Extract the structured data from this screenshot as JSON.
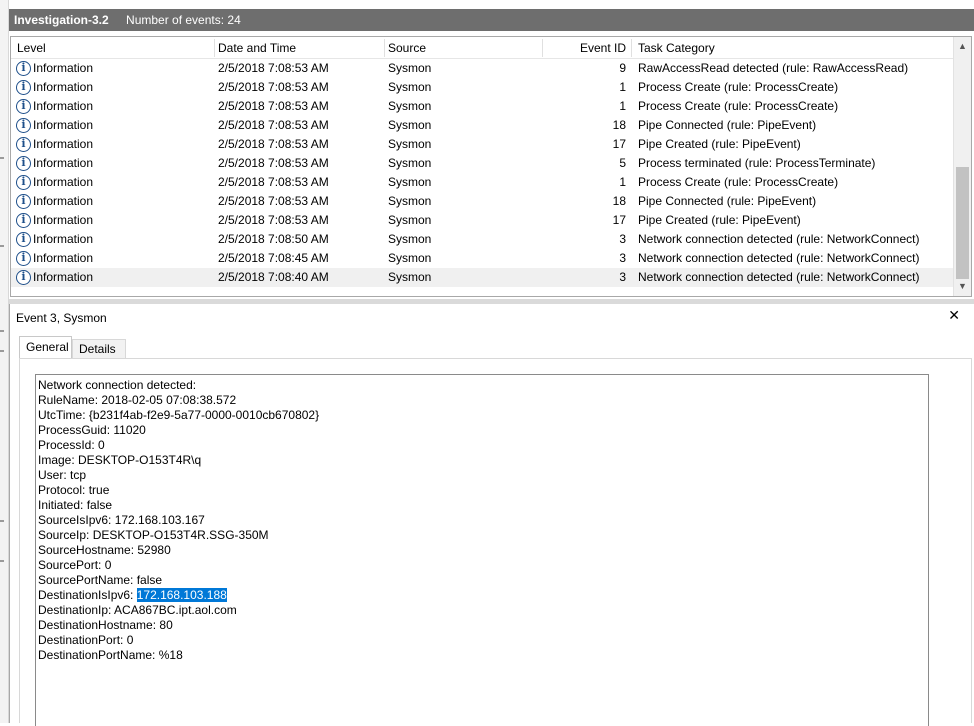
{
  "header": {
    "title": "Investigation-3.2",
    "event_count": "Number of events: 24"
  },
  "columns": {
    "level": "Level",
    "date": "Date and Time",
    "source": "Source",
    "event_id": "Event ID",
    "task": "Task Category"
  },
  "rows": [
    {
      "level": "Information",
      "date": "2/5/2018 7:08:53 AM",
      "source": "Sysmon",
      "event_id": "9",
      "task": "RawAccessRead detected (rule: RawAccessRead)"
    },
    {
      "level": "Information",
      "date": "2/5/2018 7:08:53 AM",
      "source": "Sysmon",
      "event_id": "1",
      "task": "Process Create (rule: ProcessCreate)"
    },
    {
      "level": "Information",
      "date": "2/5/2018 7:08:53 AM",
      "source": "Sysmon",
      "event_id": "1",
      "task": "Process Create (rule: ProcessCreate)"
    },
    {
      "level": "Information",
      "date": "2/5/2018 7:08:53 AM",
      "source": "Sysmon",
      "event_id": "18",
      "task": "Pipe Connected (rule: PipeEvent)"
    },
    {
      "level": "Information",
      "date": "2/5/2018 7:08:53 AM",
      "source": "Sysmon",
      "event_id": "17",
      "task": "Pipe Created (rule: PipeEvent)"
    },
    {
      "level": "Information",
      "date": "2/5/2018 7:08:53 AM",
      "source": "Sysmon",
      "event_id": "5",
      "task": "Process terminated (rule: ProcessTerminate)"
    },
    {
      "level": "Information",
      "date": "2/5/2018 7:08:53 AM",
      "source": "Sysmon",
      "event_id": "1",
      "task": "Process Create (rule: ProcessCreate)"
    },
    {
      "level": "Information",
      "date": "2/5/2018 7:08:53 AM",
      "source": "Sysmon",
      "event_id": "18",
      "task": "Pipe Connected (rule: PipeEvent)"
    },
    {
      "level": "Information",
      "date": "2/5/2018 7:08:53 AM",
      "source": "Sysmon",
      "event_id": "17",
      "task": "Pipe Created (rule: PipeEvent)"
    },
    {
      "level": "Information",
      "date": "2/5/2018 7:08:50 AM",
      "source": "Sysmon",
      "event_id": "3",
      "task": "Network connection detected (rule: NetworkConnect)"
    },
    {
      "level": "Information",
      "date": "2/5/2018 7:08:45 AM",
      "source": "Sysmon",
      "event_id": "3",
      "task": "Network connection detected (rule: NetworkConnect)"
    },
    {
      "level": "Information",
      "date": "2/5/2018 7:08:40 AM",
      "source": "Sysmon",
      "event_id": "3",
      "task": "Network connection detected (rule: NetworkConnect)"
    }
  ],
  "detail": {
    "title": "Event 3, Sysmon",
    "close_glyph": "✕",
    "tabs": {
      "general": "General",
      "details": "Details"
    },
    "lines": [
      {
        "text": "Network connection detected:"
      },
      {
        "text": "RuleName: 2018-02-05 07:08:38.572"
      },
      {
        "text": "UtcTime: {b231f4ab-f2e9-5a77-0000-0010cb670802}"
      },
      {
        "text": "ProcessGuid: 11020"
      },
      {
        "text": "ProcessId: 0"
      },
      {
        "text": "Image: DESKTOP-O153T4R\\q"
      },
      {
        "text": "User: tcp"
      },
      {
        "text": "Protocol: true"
      },
      {
        "text": "Initiated: false"
      },
      {
        "text": "SourceIsIpv6: 172.168.103.167"
      },
      {
        "text": "SourceIp: DESKTOP-O153T4R.SSG-350M"
      },
      {
        "text": "SourceHostname: 52980"
      },
      {
        "text": "SourcePort: 0"
      },
      {
        "text": "SourcePortName: false"
      },
      {
        "text": "DestinationIsIpv6: ",
        "selected": "172.168.103.188"
      },
      {
        "text": "DestinationIp: ACA867BC.ipt.aol.com"
      },
      {
        "text": "DestinationHostname: 80"
      },
      {
        "text": "DestinationPort: 0"
      },
      {
        "text": "DestinationPortName: %18"
      }
    ]
  },
  "icons": {
    "info": "information-icon",
    "scroll_up": "chevron-up-icon",
    "scroll_down": "chevron-down-icon",
    "close": "close-icon"
  },
  "colors": {
    "header_bg": "#6e6e6e",
    "selection": "#0078d7",
    "info_icon": "#1e4f8a"
  }
}
